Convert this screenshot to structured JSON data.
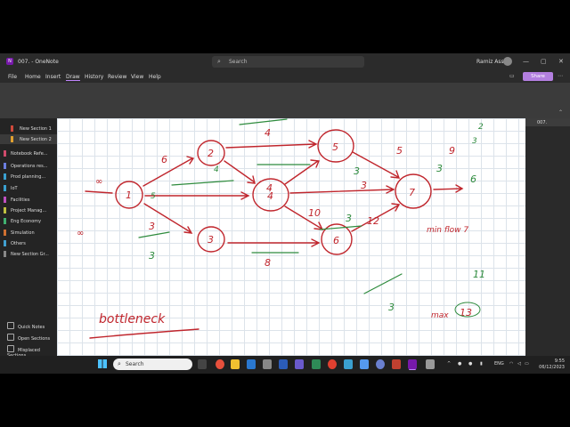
{
  "titlebar": {
    "app_icon": "N",
    "title": "007. - OneNote",
    "search_placeholder": "Search",
    "user": "Ramiz Assaf",
    "controls": [
      "—",
      "▢",
      "✕"
    ]
  },
  "menubar": {
    "items": [
      "File",
      "Home",
      "Insert",
      "Draw",
      "History",
      "Review",
      "View",
      "Help"
    ],
    "active": "Draw",
    "share_label": "Share"
  },
  "sidebar": {
    "sections": [
      {
        "label": "New Section 1",
        "color": "#d04a3b",
        "active": false
      },
      {
        "label": "New Section 2",
        "color": "#e0a030",
        "active": true
      }
    ],
    "notebooks": [
      {
        "label": "Notebook Refe...",
        "color": "#d04a6b"
      },
      {
        "label": "Operations res...",
        "color": "#6b7ee0"
      },
      {
        "label": "Prod planning...",
        "color": "#3aa0d0"
      },
      {
        "label": "IoT",
        "color": "#3aa0d0"
      },
      {
        "label": "Facilities",
        "color": "#c050c0"
      },
      {
        "label": "Project Manag...",
        "color": "#c0c040"
      },
      {
        "label": "Eng Economy",
        "color": "#40b070"
      },
      {
        "label": "Simulation",
        "color": "#d07030"
      },
      {
        "label": "Others",
        "color": "#40a0d0"
      },
      {
        "label": "New Section Gr...",
        "color": "#888888"
      }
    ],
    "bottom": [
      "Quick Notes",
      "Open Sections",
      "Misplaced Sections"
    ]
  },
  "page": {
    "title": "007."
  },
  "ink": {
    "nodes": [
      "1",
      "2",
      "3",
      "4",
      "5",
      "6",
      "7"
    ],
    "red_labels": [
      "6",
      "4",
      "4",
      "3",
      "10",
      "12",
      "8",
      "3",
      "5",
      "9",
      "min flow 7"
    ],
    "green_labels": [
      "4",
      "3",
      "3",
      "3",
      "8",
      "3",
      "6",
      "5",
      "3"
    ],
    "word": "bottleneck",
    "max_label": "max",
    "max_value": "13",
    "below_max": "11",
    "extra": [
      "∞",
      "∞",
      "2",
      "3",
      "6",
      "4",
      "4",
      "3"
    ]
  },
  "taskbar": {
    "search_placeholder": "Search",
    "tray": {
      "lang": "ENG"
    },
    "time": "9:55",
    "date": "06/12/2023"
  }
}
